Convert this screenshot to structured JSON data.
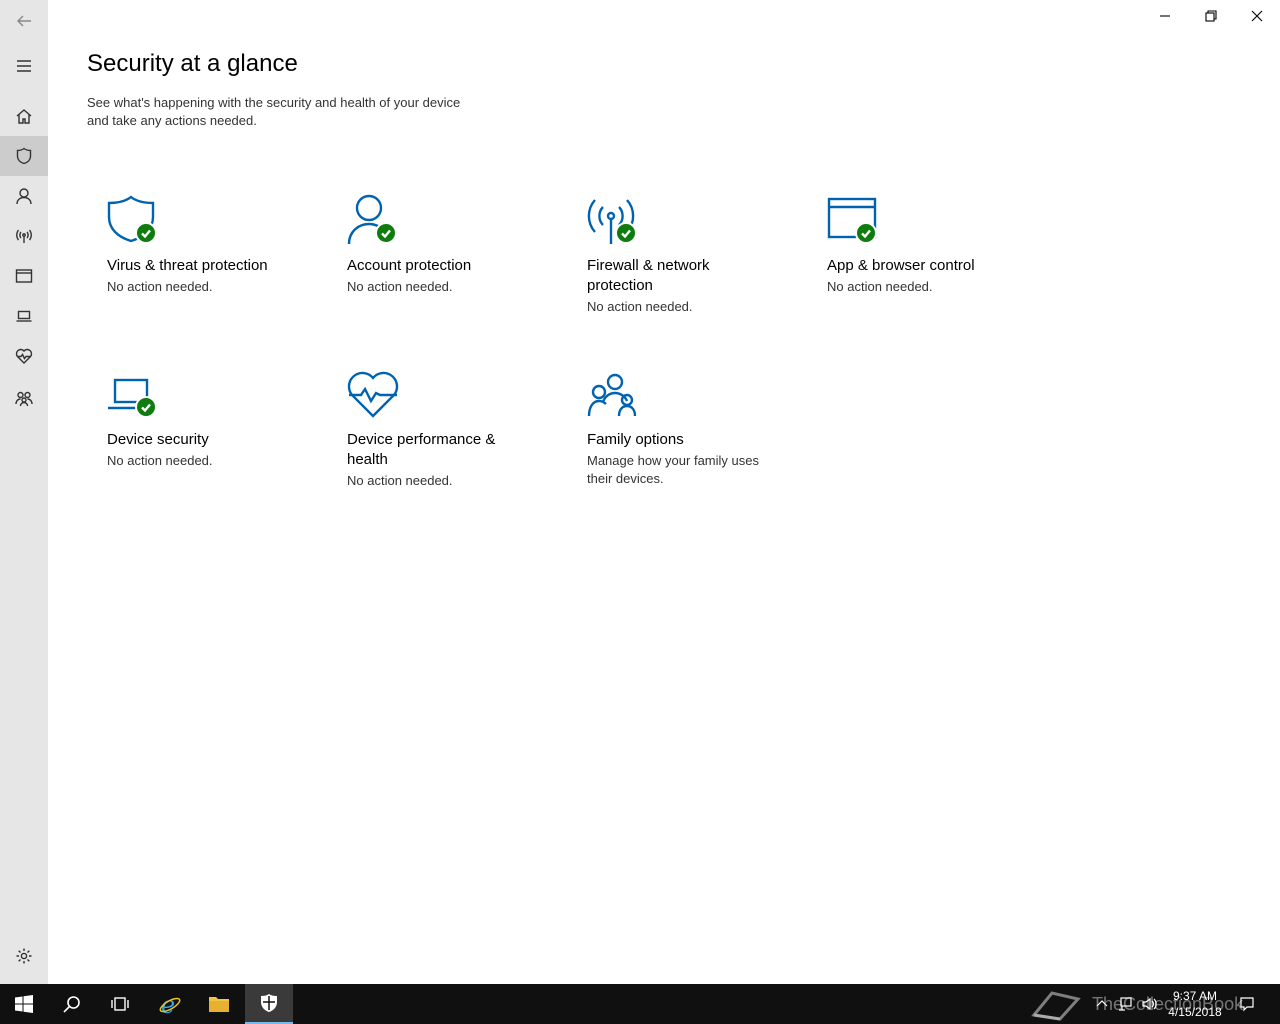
{
  "window": {
    "minimize_icon": "minimize-icon",
    "restore_icon": "restore-icon",
    "close_icon": "close-icon"
  },
  "nav": {
    "items": [
      {
        "icon": "back-arrow-icon"
      },
      {
        "icon": "hamburger-menu-icon"
      },
      {
        "icon": "home-icon"
      },
      {
        "icon": "shield-icon",
        "selected": true
      },
      {
        "icon": "person-icon"
      },
      {
        "icon": "wireless-icon"
      },
      {
        "icon": "app-window-icon"
      },
      {
        "icon": "laptop-icon"
      },
      {
        "icon": "heart-pulse-icon"
      },
      {
        "icon": "family-icon"
      },
      {
        "icon": "gear-icon"
      }
    ]
  },
  "page": {
    "title": "Security at a glance",
    "subtitle": "See what's happening with the security and health of your device and take any actions needed."
  },
  "tiles": [
    {
      "name": "Virus & threat protection",
      "status": "No action needed.",
      "icon": "shield-icon",
      "ok": true
    },
    {
      "name": "Account protection",
      "status": "No action needed.",
      "icon": "person-icon",
      "ok": true
    },
    {
      "name": "Firewall & network protection",
      "status": "No action needed.",
      "icon": "wireless-icon",
      "ok": true
    },
    {
      "name": "App & browser control",
      "status": "No action needed.",
      "icon": "app-window-icon",
      "ok": true
    },
    {
      "name": "Device security",
      "status": "No action needed.",
      "icon": "laptop-icon",
      "ok": true
    },
    {
      "name": "Device performance & health",
      "status": "No action needed.",
      "icon": "heart-pulse-icon",
      "ok": true
    },
    {
      "name": "Family options",
      "status": "Manage how your family uses their devices.",
      "icon": "family-icon",
      "ok": false
    }
  ],
  "taskbar": {
    "time": "9:37 AM",
    "date": "4/15/2018",
    "watermark": "TheCollectionBook"
  },
  "colors": {
    "accent": "#0063b1",
    "ok": "#107c10",
    "rail": "#e6e6e6",
    "taskbar": "#101010"
  }
}
